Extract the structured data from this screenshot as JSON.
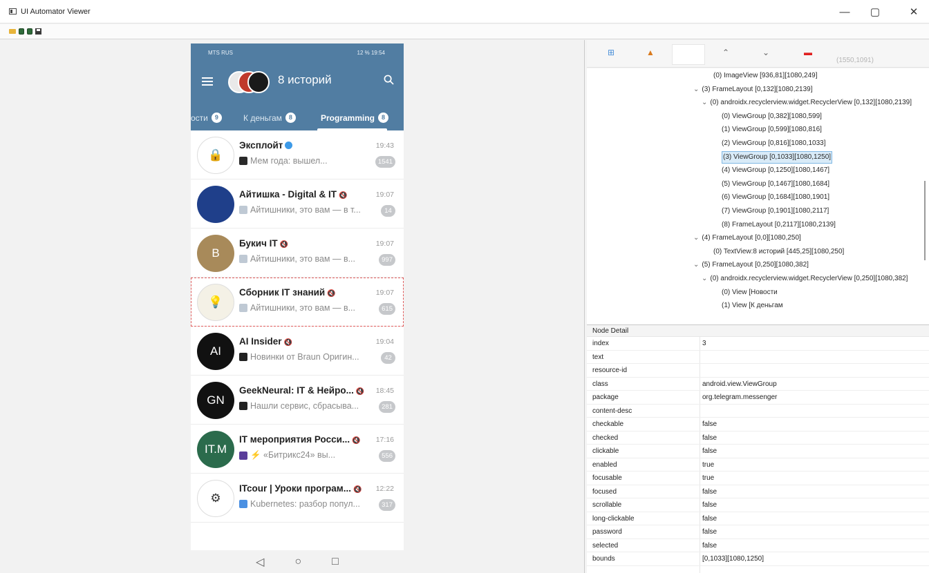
{
  "window": {
    "title": "UI Automator Viewer",
    "controls": [
      "—",
      "▢",
      "✕"
    ]
  },
  "toolbar_icons": [
    "folder-open-icon",
    "device-screenshot-icon",
    "device-screenshot-compressed-icon",
    "save-icon"
  ],
  "phone": {
    "status_left": "MTS RUS",
    "status_right": "12 % 19:54",
    "header_title": "8 историй",
    "tabs": [
      {
        "label": "ости",
        "count": "9"
      },
      {
        "label": "К деньгам",
        "count": "8"
      },
      {
        "label": "Programming",
        "count": "8"
      }
    ],
    "chats": [
      {
        "name": "Эксплойт",
        "time": "19:43",
        "preview": "Мем года: вышел...",
        "badge": "1541",
        "avatar_color": "#ffffff",
        "avatar_text": "🔒"
      },
      {
        "name": "Айтишка - Digital & IT",
        "time": "19:07",
        "preview": "Айтишники, это вам — в т...",
        "badge": "14",
        "avatar_color": "#1f3f8a",
        "avatar_text": ""
      },
      {
        "name": "Букич IT",
        "time": "19:07",
        "preview": "Айтишники, это вам — в...",
        "badge": "997",
        "avatar_color": "#a88a5a",
        "avatar_text": "B"
      },
      {
        "name": "Сборник IT знаний",
        "time": "19:07",
        "preview": "Айтишники, это вам — в...",
        "badge": "615",
        "avatar_color": "#f4f1e6",
        "avatar_text": "💡"
      },
      {
        "name": "AI Insider",
        "time": "19:04",
        "preview": "Новинки от Braun  Оригин...",
        "badge": "42",
        "avatar_color": "#111111",
        "avatar_text": "AI"
      },
      {
        "name": "GeekNeural: IT & Нейро...",
        "time": "18:45",
        "preview": "Нашли сервис, сбрасыва...",
        "badge": "281",
        "avatar_color": "#111111",
        "avatar_text": "GN"
      },
      {
        "name": "IT мероприятия Росси...",
        "time": "17:16",
        "preview": "⚡ «Битрикс24» вы...",
        "badge": "556",
        "avatar_color": "#2b6b4c",
        "avatar_text": "IT.M"
      },
      {
        "name": "ITcour | Уроки програм...",
        "time": "12:22",
        "preview": "Kubernetes: разбор попул...",
        "badge": "317",
        "avatar_color": "#ffffff",
        "avatar_text": "⚙"
      }
    ],
    "nav": [
      "◁",
      "○",
      "□"
    ]
  },
  "hierarchy": {
    "coords": "(1550,1091)",
    "rows": [
      {
        "indent": 183,
        "caret": "",
        "text": "(0) ImageView [936,81][1080,249]"
      },
      {
        "indent": 154,
        "caret": "⌄",
        "text": "(3) FrameLayout [0,132][1080,2139]"
      },
      {
        "indent": 166,
        "caret": "⌄",
        "text": "(0) androidx.recyclerview.widget.RecyclerView [0,132][1080,2139]"
      },
      {
        "indent": 195,
        "caret": "",
        "text": "(0) ViewGroup [0,382][1080,599]"
      },
      {
        "indent": 195,
        "caret": "",
        "text": "(1) ViewGroup [0,599][1080,816]"
      },
      {
        "indent": 195,
        "caret": "",
        "text": "(2) ViewGroup [0,816][1080,1033]"
      },
      {
        "indent": 195,
        "caret": "",
        "text": "(3) ViewGroup [0,1033][1080,1250]",
        "selected": true
      },
      {
        "indent": 195,
        "caret": "",
        "text": "(4) ViewGroup [0,1250][1080,1467]"
      },
      {
        "indent": 195,
        "caret": "",
        "text": "(5) ViewGroup [0,1467][1080,1684]"
      },
      {
        "indent": 195,
        "caret": "",
        "text": "(6) ViewGroup [0,1684][1080,1901]"
      },
      {
        "indent": 195,
        "caret": "",
        "text": "(7) ViewGroup [0,1901][1080,2117]"
      },
      {
        "indent": 195,
        "caret": "",
        "text": "(8) FrameLayout [0,2117][1080,2139]"
      },
      {
        "indent": 154,
        "caret": "⌄",
        "text": "(4) FrameLayout [0,0][1080,250]"
      },
      {
        "indent": 183,
        "caret": "",
        "text": "(0) TextView:8 историй [445,25][1080,250]"
      },
      {
        "indent": 154,
        "caret": "⌄",
        "text": "(5) FrameLayout [0,250][1080,382]"
      },
      {
        "indent": 166,
        "caret": "⌄",
        "text": "(0) androidx.recyclerview.widget.RecyclerView [0,250][1080,382]"
      },
      {
        "indent": 195,
        "caret": "",
        "text": "(0) View [Новости"
      },
      {
        "indent": 195,
        "caret": "",
        "text": "(1) View [К деньгам"
      }
    ]
  },
  "node_detail": {
    "header": "Node Detail",
    "rows": [
      {
        "key": "index",
        "value": "3"
      },
      {
        "key": "text",
        "value": ""
      },
      {
        "key": "resource-id",
        "value": ""
      },
      {
        "key": "class",
        "value": "android.view.ViewGroup"
      },
      {
        "key": "package",
        "value": "org.telegram.messenger"
      },
      {
        "key": "content-desc",
        "value": ""
      },
      {
        "key": "checkable",
        "value": "false"
      },
      {
        "key": "checked",
        "value": "false"
      },
      {
        "key": "clickable",
        "value": "false"
      },
      {
        "key": "enabled",
        "value": "true"
      },
      {
        "key": "focusable",
        "value": "true"
      },
      {
        "key": "focused",
        "value": "false"
      },
      {
        "key": "scrollable",
        "value": "false"
      },
      {
        "key": "long-clickable",
        "value": "false"
      },
      {
        "key": "password",
        "value": "false"
      },
      {
        "key": "selected",
        "value": "false"
      },
      {
        "key": "bounds",
        "value": "[0,1033][1080,1250]"
      }
    ]
  }
}
